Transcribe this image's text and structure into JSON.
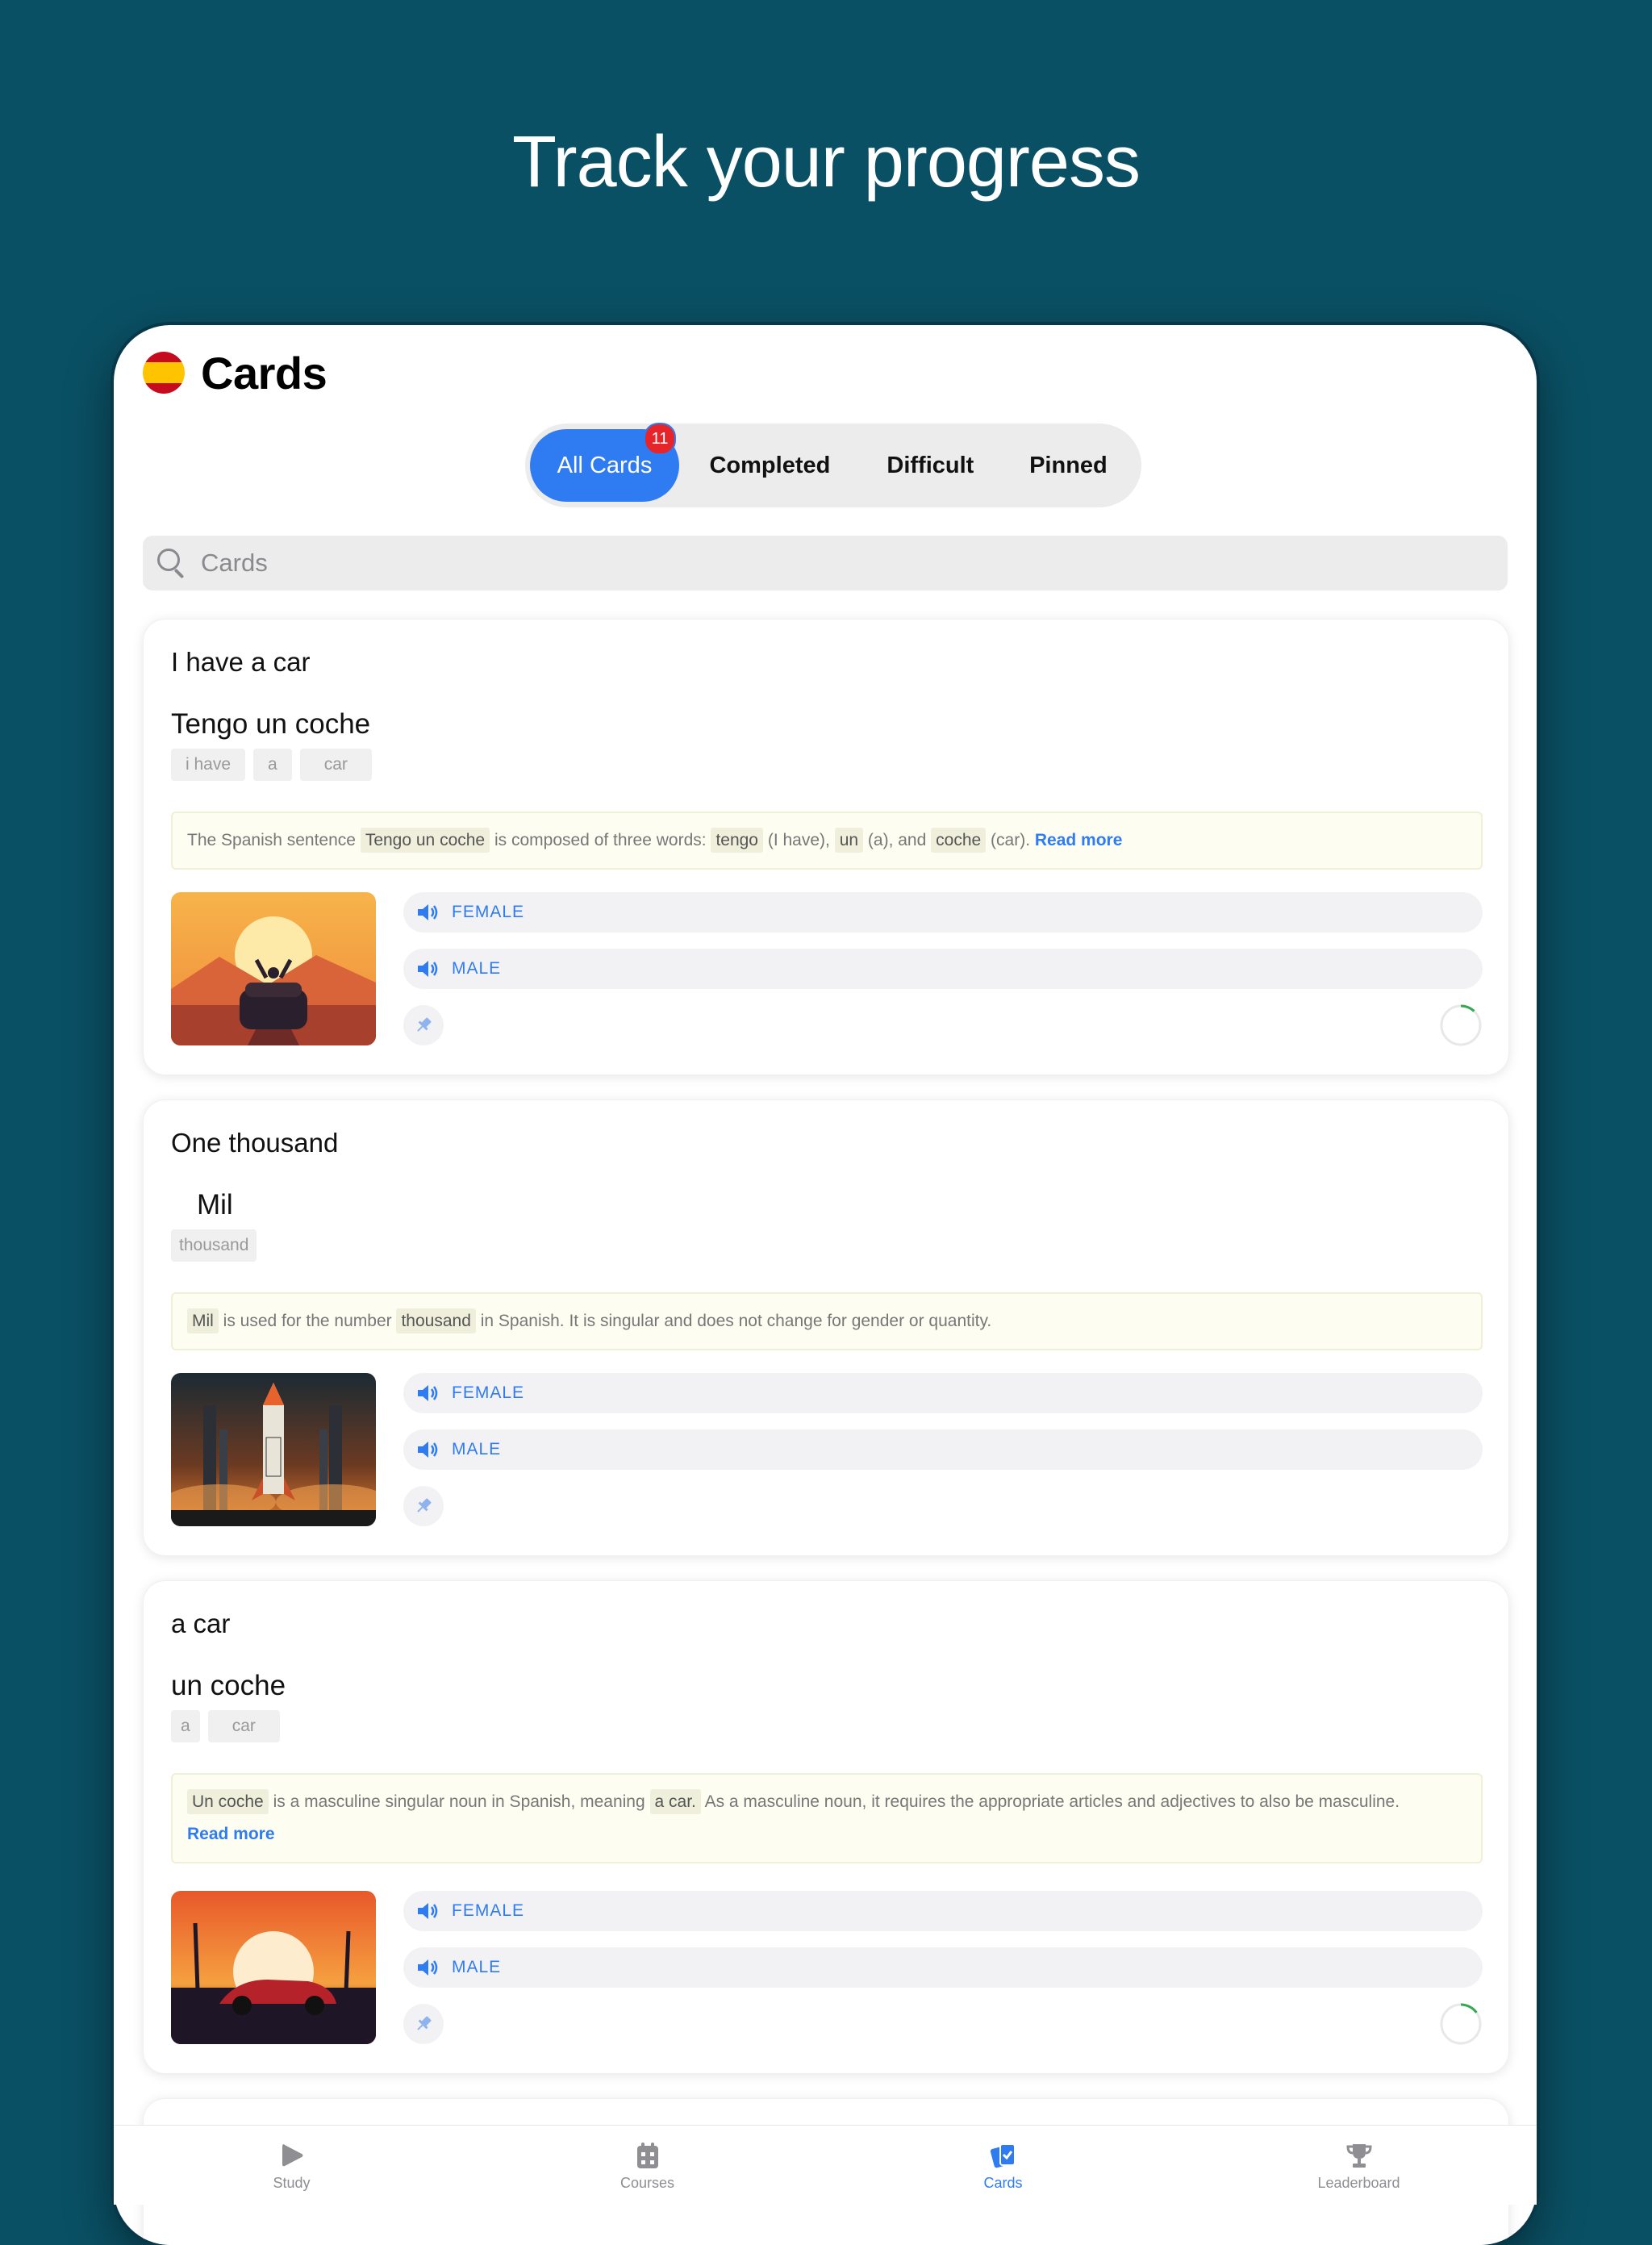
{
  "headline": "Track your progress",
  "header": {
    "title": "Cards",
    "flag_icon": "spain-flag-icon"
  },
  "segments": {
    "all": "All Cards",
    "all_badge": "11",
    "completed": "Completed",
    "difficult": "Difficult",
    "pinned": "Pinned",
    "active": "All Cards"
  },
  "search": {
    "placeholder": "Cards"
  },
  "cards": [
    {
      "english": "I have a car",
      "spanish": "Tengo un coche",
      "chips": [
        "i have",
        "a",
        "car"
      ],
      "note": {
        "p1": "The Spanish sentence",
        "h1": "Tengo un coche",
        "p2": "is composed of three words:",
        "h2": "tengo",
        "p3": "(I have),",
        "h3": "un",
        "p4": "(a), and",
        "h4": "coche",
        "p5": "(car).",
        "read_more": "Read more"
      },
      "female": "FEMALE",
      "male": "MALE",
      "image": "car-sunset-illustration",
      "progress": 0.12
    },
    {
      "english": "One thousand",
      "spanish": "Mil",
      "chips": [
        "thousand"
      ],
      "note": {
        "h1": "Mil",
        "p1": "is used for the number",
        "h2": "thousand",
        "p2": "in Spanish. It is singular and does not change for gender or quantity."
      },
      "female": "FEMALE",
      "male": "MALE",
      "image": "rocket-launch-illustration"
    },
    {
      "english": "a car",
      "spanish": "un coche",
      "chips": [
        "a",
        "car"
      ],
      "note": {
        "h1": "Un coche",
        "p1": "is a masculine singular noun in Spanish, meaning",
        "h2": "a car.",
        "p2": "As a masculine noun, it requires the appropriate articles and adjectives to also be masculine.",
        "read_more": "Read more"
      },
      "female": "FEMALE",
      "male": "MALE",
      "image": "red-car-sunset-illustration",
      "progress": 0.15
    }
  ],
  "tabbar": [
    {
      "label": "Study",
      "icon": "play-icon"
    },
    {
      "label": "Courses",
      "icon": "calendar-icon"
    },
    {
      "label": "Cards",
      "icon": "cards-icon",
      "active": true
    },
    {
      "label": "Leaderboard",
      "icon": "trophy-icon"
    }
  ],
  "colors": {
    "background": "#0a5064",
    "accent": "#2f7cf2",
    "badge": "#e5252a",
    "progress": "#34a853"
  }
}
